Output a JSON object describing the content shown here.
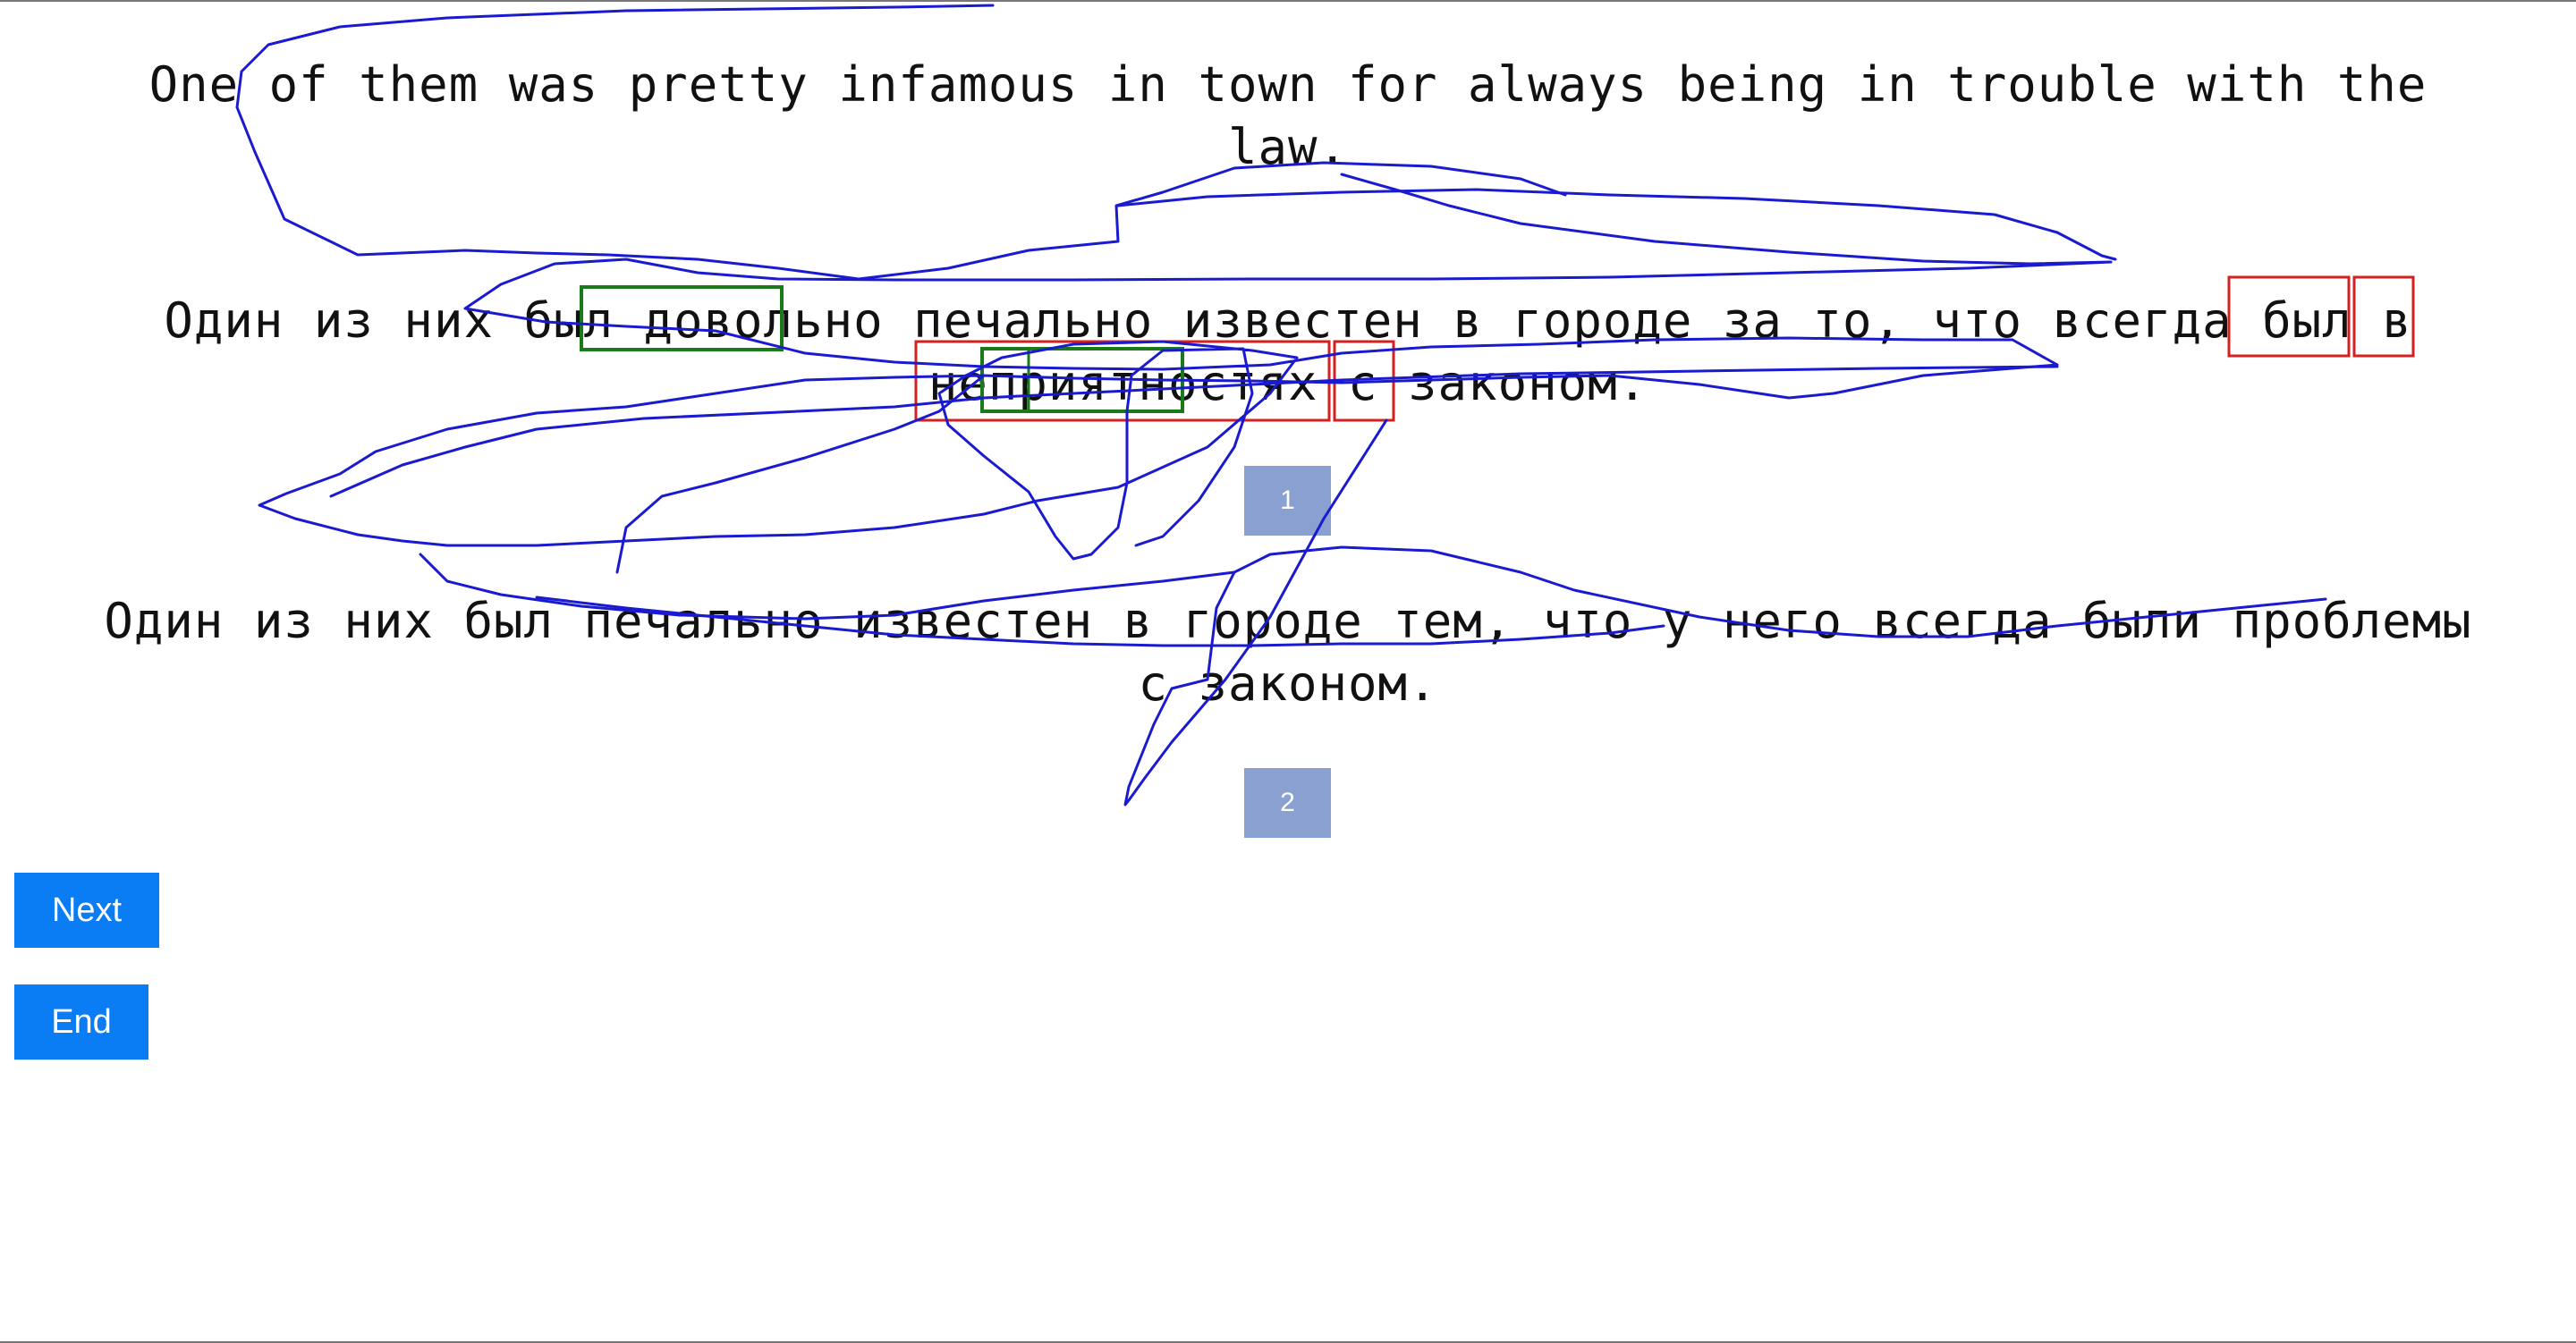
{
  "source_sentence": "One of them was pretty infamous in town for always being in trouble with the law.",
  "translations": [
    {
      "text": "Один из них был довольно печально известен в городе за то, что всегда был в неприятностях с законом.",
      "button_label": "1"
    },
    {
      "text": "Один из них был печально известен в городе тем, что у него всегда были проблемы с законом.",
      "button_label": "2"
    }
  ],
  "buttons": {
    "next": "Next",
    "end": "End"
  },
  "colors": {
    "gaze_trace": "#1a1ad0",
    "highlight_green": "#1a7a1a",
    "highlight_red": "#d42020",
    "number_button": "#8aa0d0",
    "nav_button": "#0a7df5"
  }
}
